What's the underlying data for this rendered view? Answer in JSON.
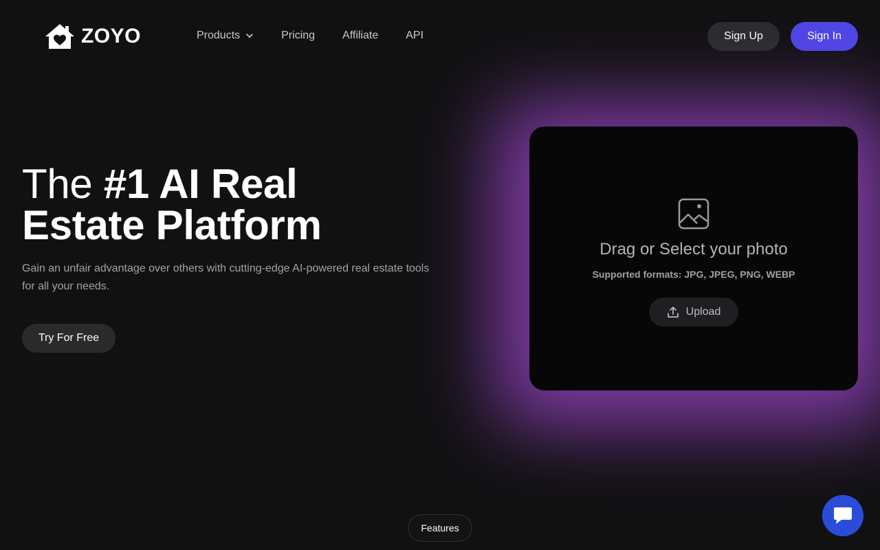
{
  "brand": {
    "name": "ZOYO",
    "accent_color": "#4f46e5",
    "glow_color": "#8b3fb4",
    "logo_icon": "house-heart-icon"
  },
  "nav": {
    "items": [
      {
        "label": "Products",
        "has_dropdown": true
      },
      {
        "label": "Pricing"
      },
      {
        "label": "Affiliate"
      },
      {
        "label": "API"
      }
    ]
  },
  "auth": {
    "signup_label": "Sign Up",
    "signin_label": "Sign In"
  },
  "hero": {
    "title_lead": "The ",
    "title_strong_1": "#1 AI Real",
    "title_strong_2": "Estate Platform",
    "subtitle": "Gain an unfair advantage over others with cutting-edge AI-powered real estate tools for all your needs.",
    "cta_label": "Try For Free"
  },
  "upload": {
    "icon": "image-icon",
    "drag_text": "Drag or Select your photo",
    "formats_text": "Supported formats: JPG, JPEG, PNG, WEBP",
    "button_label": "Upload",
    "button_icon": "upload-icon"
  },
  "footer": {
    "features_label": "Features",
    "chat_icon": "chat-icon",
    "chat_color": "#2b4cd9"
  }
}
